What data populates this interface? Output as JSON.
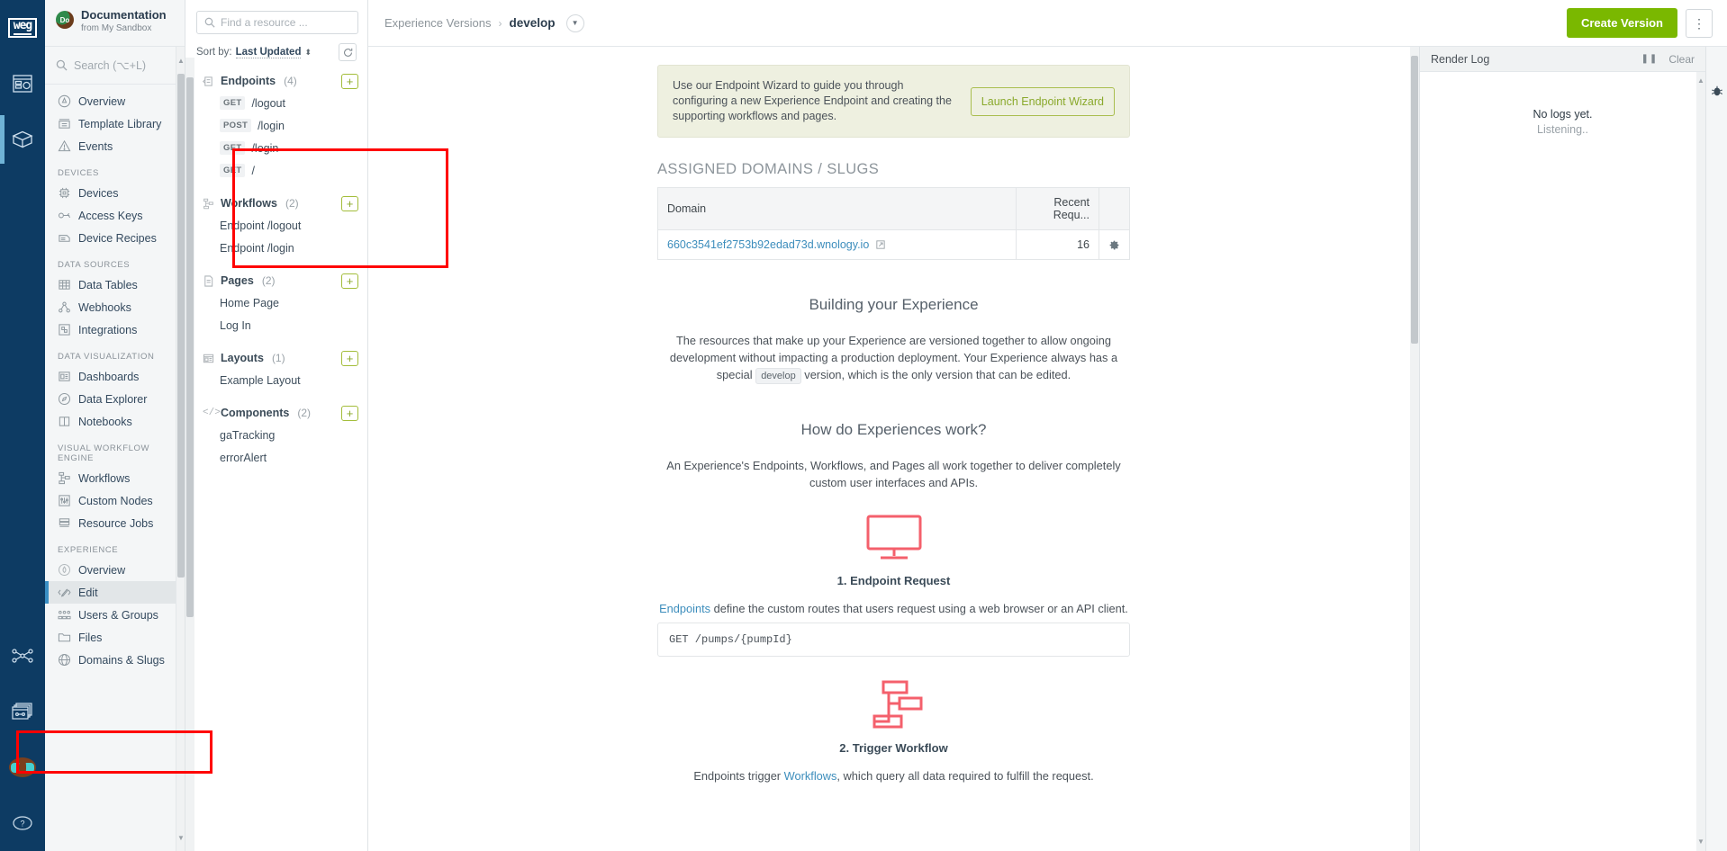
{
  "rail": {
    "logo": "weg",
    "items": [
      {
        "name": "dashboards-rail-icon",
        "label": "Dashboards"
      },
      {
        "name": "applications-rail-icon",
        "label": "Applications",
        "active": true
      },
      {
        "name": "workflows-rail-icon",
        "label": "Workflows"
      },
      {
        "name": "experiences-rail-icon",
        "label": "Experiences"
      },
      {
        "name": "debug-rail-icon",
        "label": "Debug"
      },
      {
        "name": "help-rail-icon",
        "label": "Help"
      }
    ]
  },
  "sidebar": {
    "app_title": "Documentation",
    "app_subtitle": "from My Sandbox",
    "avatar_initials": "Do",
    "search_placeholder": "Search (⌥+L)",
    "groups": [
      {
        "label": "",
        "items": [
          {
            "label": "Overview",
            "icon": "overview-icon"
          },
          {
            "label": "Template Library",
            "icon": "template-library-icon"
          },
          {
            "label": "Events",
            "icon": "events-icon"
          }
        ]
      },
      {
        "label": "DEVICES",
        "items": [
          {
            "label": "Devices",
            "icon": "devices-icon"
          },
          {
            "label": "Access Keys",
            "icon": "access-keys-icon"
          },
          {
            "label": "Device Recipes",
            "icon": "device-recipes-icon"
          }
        ]
      },
      {
        "label": "DATA SOURCES",
        "items": [
          {
            "label": "Data Tables",
            "icon": "data-tables-icon"
          },
          {
            "label": "Webhooks",
            "icon": "webhooks-icon"
          },
          {
            "label": "Integrations",
            "icon": "integrations-icon"
          }
        ]
      },
      {
        "label": "DATA VISUALIZATION",
        "items": [
          {
            "label": "Dashboards",
            "icon": "dashboards-icon"
          },
          {
            "label": "Data Explorer",
            "icon": "data-explorer-icon"
          },
          {
            "label": "Notebooks",
            "icon": "notebooks-icon"
          }
        ]
      },
      {
        "label": "VISUAL WORKFLOW ENGINE",
        "items": [
          {
            "label": "Workflows",
            "icon": "workflows-icon"
          },
          {
            "label": "Custom Nodes",
            "icon": "custom-nodes-icon"
          },
          {
            "label": "Resource Jobs",
            "icon": "resource-jobs-icon"
          }
        ]
      },
      {
        "label": "EXPERIENCE",
        "items": [
          {
            "label": "Overview",
            "icon": "experience-overview-icon"
          },
          {
            "label": "Edit",
            "icon": "edit-icon",
            "active": true
          },
          {
            "label": "Users & Groups",
            "icon": "users-groups-icon"
          },
          {
            "label": "Files",
            "icon": "files-icon"
          },
          {
            "label": "Domains & Slugs",
            "icon": "domains-slugs-icon"
          }
        ]
      }
    ]
  },
  "tree": {
    "search_placeholder": "Find a resource ...",
    "sort_label": "Sort by:",
    "sort_value": "Last Updated",
    "refresh_icon": "refresh-icon",
    "add_label": "+",
    "sections": [
      {
        "title": "Endpoints",
        "count": "(4)",
        "icon": "endpoints-icon",
        "items": [
          {
            "verb": "GET",
            "label": "/logout"
          },
          {
            "verb": "POST",
            "label": "/login"
          },
          {
            "verb": "GET",
            "label": "/login"
          },
          {
            "verb": "GET",
            "label": "/"
          }
        ]
      },
      {
        "title": "Workflows",
        "count": "(2)",
        "icon": "workflows-tree-icon",
        "items": [
          {
            "verb": "",
            "label": "Endpoint /logout"
          },
          {
            "verb": "",
            "label": "Endpoint /login"
          }
        ]
      },
      {
        "title": "Pages",
        "count": "(2)",
        "icon": "pages-icon",
        "items": [
          {
            "verb": "",
            "label": "Home Page"
          },
          {
            "verb": "",
            "label": "Log In"
          }
        ]
      },
      {
        "title": "Layouts",
        "count": "(1)",
        "icon": "layouts-icon",
        "items": [
          {
            "verb": "",
            "label": "Example Layout"
          }
        ]
      },
      {
        "title": "Components",
        "count": "(2)",
        "icon": "components-icon",
        "items": [
          {
            "verb": "",
            "label": "gaTracking"
          },
          {
            "verb": "",
            "label": "errorAlert"
          }
        ]
      }
    ]
  },
  "topbar": {
    "breadcrumb_parent": "Experience Versions",
    "breadcrumb_sep": "›",
    "breadcrumb_current": "develop",
    "create_label": "Create Version",
    "kebab_label": "⋮"
  },
  "main": {
    "wizard_text": "Use our Endpoint Wizard to guide you through configuring a new Experience Endpoint and creating the supporting workflows and pages.",
    "wizard_button": "Launch Endpoint Wizard",
    "domains_title": "ASSIGNED DOMAINS / SLUGS",
    "domains_table": {
      "headers": [
        "Domain",
        "Recent Requ...",
        ""
      ],
      "rows": [
        {
          "domain": "660c3541ef2753b92edad73d.wnology.io",
          "recent_requests": "16",
          "gear": "gear-icon"
        }
      ]
    },
    "building_heading": "Building your Experience",
    "building_para_1": "The resources that make up your Experience are versioned together to allow ongoing development without impacting a production deployment. Your Experience always has a special",
    "building_tag": "develop",
    "building_para_2": "version, which is the only version that can be edited.",
    "how_heading": "How do Experiences work?",
    "how_para": "An Experience's Endpoints, Workflows, and Pages all work together to deliver completely custom user interfaces and APIs.",
    "step1_title": "1. Endpoint Request",
    "step1_link": "Endpoints",
    "step1_para": " define the custom routes that users request using a web browser or an API client.",
    "step1_code": "GET /pumps/{pumpId}",
    "step2_title": "2. Trigger Workflow",
    "step2_para_pre": "Endpoints trigger ",
    "step2_link": "Workflows",
    "step2_para_post": ", which query all data required to fulfill the request."
  },
  "log": {
    "title": "Render Log",
    "pause_label": "❚❚",
    "clear_label": "Clear",
    "empty_title": "No logs yet.",
    "empty_sub": "Listening.."
  },
  "colors": {
    "rail_bg": "#0d3b63",
    "accent_green": "#7ab800",
    "link_blue": "#3c8dbc",
    "annotation_red": "#ff0000",
    "art_red": "#f4606c"
  }
}
